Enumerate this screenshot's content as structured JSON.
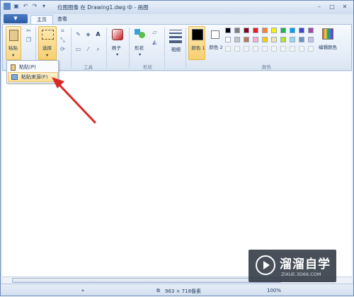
{
  "titlebar": {
    "title": "位图图像 在 Drawing1.dwg 中 - 画图",
    "qat_icons": [
      "save-icon",
      "undo-icon",
      "redo-icon",
      "qat-dropdown-icon"
    ],
    "window_buttons": [
      "minimize-icon",
      "maximize-icon",
      "close-icon"
    ]
  },
  "tabs": {
    "menu_label": "▼",
    "home": "主页",
    "view": "查看"
  },
  "ribbon": {
    "clipboard": {
      "paste_label": "粘贴"
    },
    "image": {
      "select_label": "选择"
    },
    "tools": {
      "group_label": "工具"
    },
    "brushes": {
      "label": "刷子"
    },
    "shapes": {
      "shapes_label": "形状",
      "group_label": "形状"
    },
    "size": {
      "label": "粗细"
    },
    "colors": {
      "color1_label": "颜色 1",
      "color2_label": "颜色 2",
      "edit_label": "编辑颜色",
      "group_label": "颜色",
      "palette_row1": [
        "#000000",
        "#7f7f7f",
        "#880015",
        "#ed1c24",
        "#ff7f27",
        "#fff200",
        "#22b14c",
        "#00a2e8",
        "#3f48cc",
        "#a349a4"
      ],
      "palette_row2": [
        "#ffffff",
        "#c3c3c3",
        "#b97a57",
        "#ffaec9",
        "#ffc90e",
        "#efe4b0",
        "#b5e61d",
        "#99d9ea",
        "#7092be",
        "#c8bfe7"
      ]
    }
  },
  "paste_menu": {
    "paste": "粘贴(P)",
    "paste_from": "粘贴来源(F)"
  },
  "status": {
    "image_size": "963 × 718像素",
    "zoom": "100%"
  },
  "watermark": {
    "cn": "溜溜自学",
    "en": "ZIXUE.3D66.COM"
  }
}
